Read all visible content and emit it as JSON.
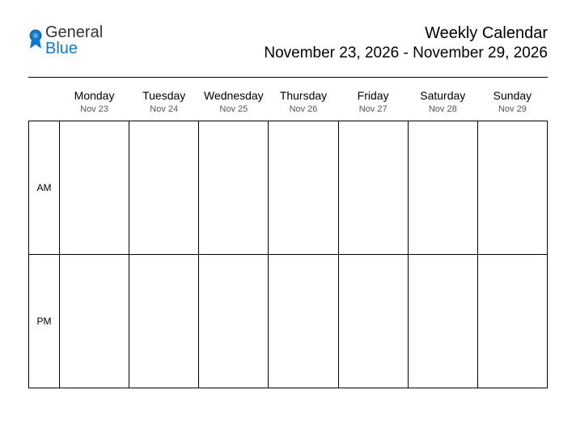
{
  "logo": {
    "general": "General",
    "blue": "Blue"
  },
  "header": {
    "title": "Weekly Calendar",
    "range": "November 23, 2026 - November 29, 2026"
  },
  "periods": {
    "am": "AM",
    "pm": "PM"
  },
  "days": [
    {
      "name": "Monday",
      "date": "Nov 23"
    },
    {
      "name": "Tuesday",
      "date": "Nov 24"
    },
    {
      "name": "Wednesday",
      "date": "Nov 25"
    },
    {
      "name": "Thursday",
      "date": "Nov 26"
    },
    {
      "name": "Friday",
      "date": "Nov 27"
    },
    {
      "name": "Saturday",
      "date": "Nov 28"
    },
    {
      "name": "Sunday",
      "date": "Nov 29"
    }
  ]
}
